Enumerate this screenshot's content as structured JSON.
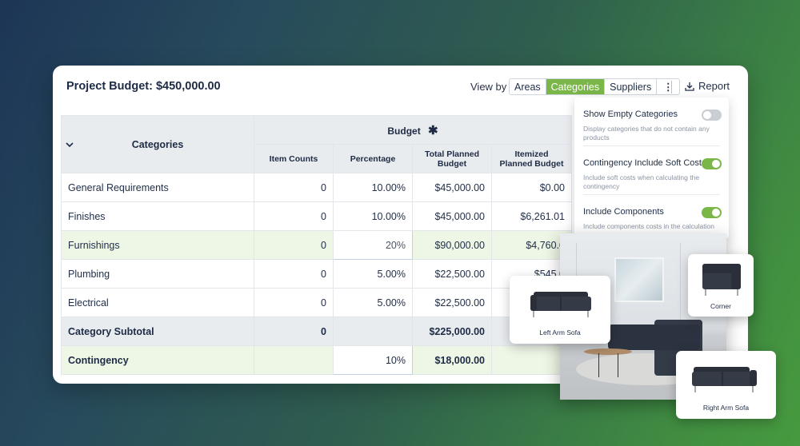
{
  "header": {
    "title": "Project Budget: $450,000.00",
    "view_by_label": "View by",
    "view_options": [
      "Areas",
      "Categories",
      "Suppliers"
    ],
    "active_view": "Categories",
    "more_label": "⋮",
    "report_label": "Report"
  },
  "table": {
    "categories_header": "Categories",
    "budget_header": "Budget",
    "columns": [
      "Item Counts",
      "Percentage",
      "Total Planned Budget",
      "Itemized Planned Budget"
    ],
    "rows": [
      {
        "name": "General Requirements",
        "count": "0",
        "percent": "10.00%",
        "total": "$45,000.00",
        "itemized": "$0.00"
      },
      {
        "name": "Finishes",
        "count": "0",
        "percent": "10.00%",
        "total": "$45,000.00",
        "itemized": "$6,261.01"
      },
      {
        "name": "Furnishings",
        "count": "0",
        "percent": "20%",
        "total": "$90,000.00",
        "itemized": "$4,760.0"
      },
      {
        "name": "Plumbing",
        "count": "0",
        "percent": "5.00%",
        "total": "$22,500.00",
        "itemized": "$545.0"
      },
      {
        "name": "Electrical",
        "count": "0",
        "percent": "5.00%",
        "total": "$22,500.00",
        "itemized": ""
      }
    ],
    "subtotal": {
      "name": "Category Subtotal",
      "count": "0",
      "total": "$225,000.00"
    },
    "contingency": {
      "name": "Contingency",
      "percent": "10%",
      "total": "$18,000.00"
    }
  },
  "dropdown": {
    "options": [
      {
        "label": "Show Empty Categories",
        "description": "Display categories that do not contain any products",
        "enabled": false
      },
      {
        "label": "Contingency Include Soft Cost",
        "description": "Include soft costs when calculating the contingency",
        "enabled": true
      },
      {
        "label": "Include Components",
        "description": "Include components costs in the calculation",
        "enabled": true
      }
    ]
  },
  "products": {
    "left_arm_sofa": "Left Arm Sofa",
    "corner": "Corner",
    "right_arm_sofa": "Right Arm Sofa"
  },
  "colors": {
    "accent": "#7ab648",
    "highlight_row": "#eef6e6",
    "header_bg": "#e9ecef",
    "title_text": "#1e2b45"
  }
}
